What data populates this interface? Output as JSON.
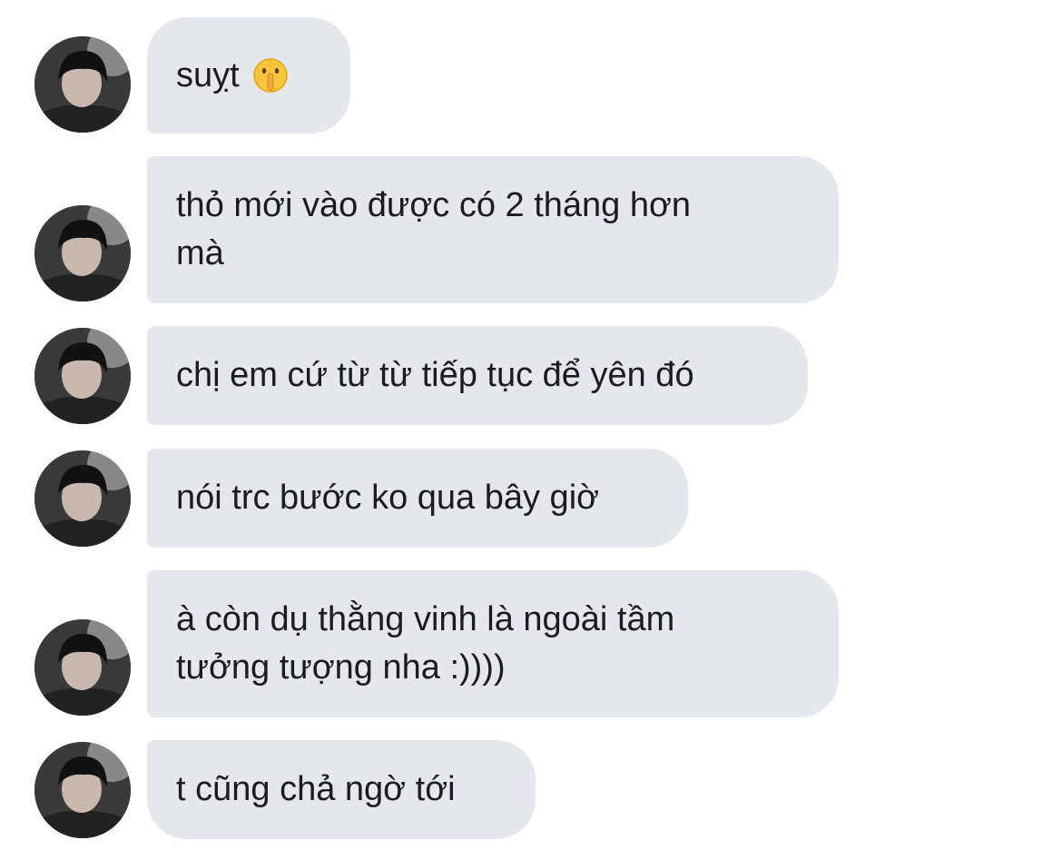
{
  "conversation": {
    "messages": [
      {
        "text": "suỵt",
        "emoji": "shushing-face-emoji"
      },
      {
        "text": "thỏ mới vào được có 2 tháng hơn\nmà"
      },
      {
        "text": "chị em cứ từ từ tiếp tục để yên đó"
      },
      {
        "text": "nói trc bước ko qua bây giờ"
      },
      {
        "text": "à còn dụ thằng vinh là ngoài tầm\ntưởng tượng nha :))))"
      },
      {
        "text": "t cũng chả ngờ tới"
      }
    ]
  },
  "colors": {
    "bubble_background": "#e4e7ec",
    "text": "#1c1c1e",
    "page_background": "#ffffff"
  }
}
